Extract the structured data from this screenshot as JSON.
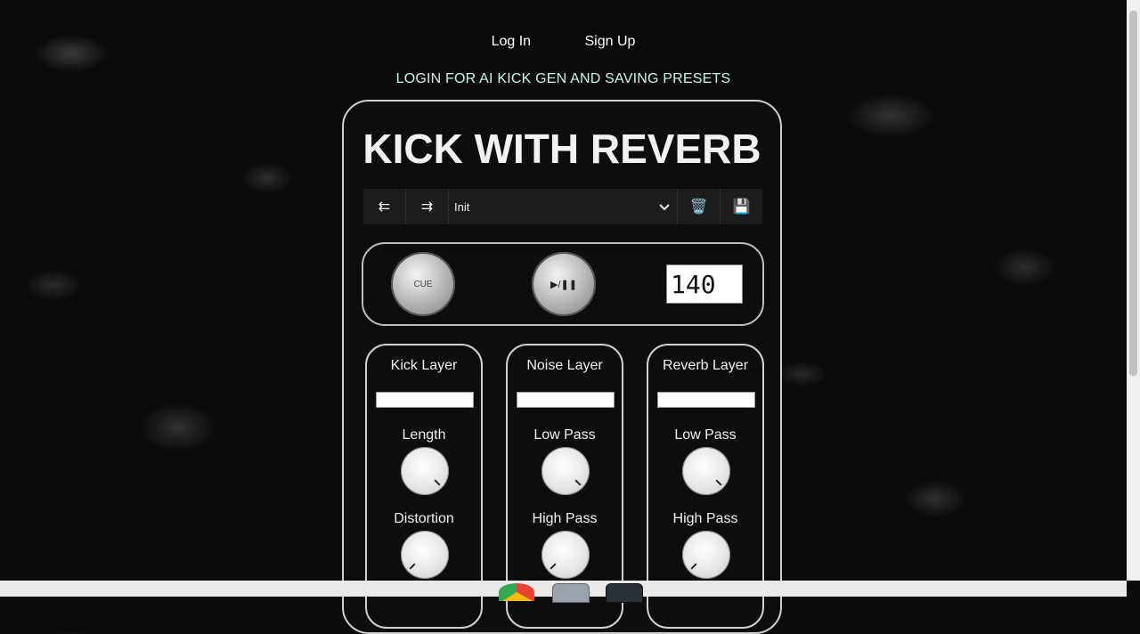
{
  "nav": {
    "login": "Log In",
    "signup": "Sign Up"
  },
  "promo": "LOGIN FOR AI KICK GEN AND SAVING PRESETS",
  "title": "KICK WITH REVERB",
  "toolbar": {
    "prev_icon": "⇇",
    "next_icon": "⇉",
    "preset_value": "Init",
    "delete_icon": "🗑️",
    "save_icon": "💾"
  },
  "transport": {
    "cue_label": "CUE",
    "play_label": "▶/❚❚",
    "bpm": "140"
  },
  "layers": [
    {
      "name": "Kick Layer",
      "select_value": "",
      "params": [
        {
          "label": "Length",
          "level": 0.85
        },
        {
          "label": "Distortion",
          "level": 0.1
        }
      ]
    },
    {
      "name": "Noise Layer",
      "select_value": "",
      "params": [
        {
          "label": "Low Pass",
          "level": 0.85
        },
        {
          "label": "High Pass",
          "level": 0.1
        }
      ]
    },
    {
      "name": "Reverb Layer",
      "select_value": "",
      "params": [
        {
          "label": "Low Pass",
          "level": 0.85
        },
        {
          "label": "High Pass",
          "level": 0.1
        }
      ]
    }
  ],
  "colors": {
    "background": "#0b0b0b",
    "promo": "#c8f5e6",
    "panel_border": "#cfcfcf"
  }
}
